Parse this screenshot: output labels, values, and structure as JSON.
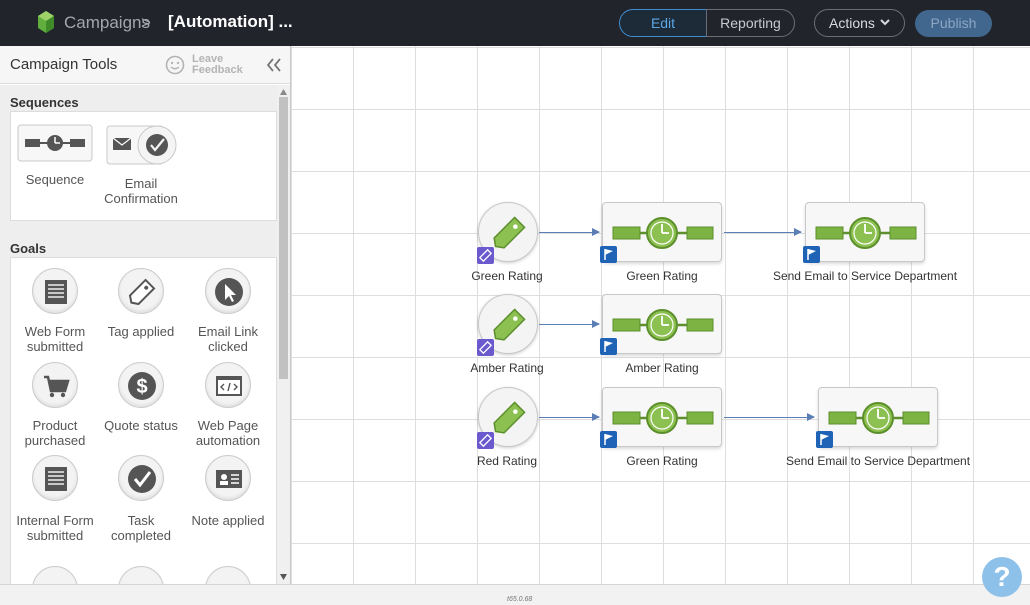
{
  "header": {
    "breadcrumb_root": "Campaigns",
    "breadcrumb_separator": ">",
    "breadcrumb_current": "[Automation] ...",
    "tabs": [
      {
        "label": "Edit",
        "active": true
      },
      {
        "label": "Reporting",
        "active": false
      }
    ],
    "actions_label": "Actions",
    "publish_label": "Publish"
  },
  "sidebar": {
    "title": "Campaign Tools",
    "feedback_line1": "Leave",
    "feedback_line2": "Feedback",
    "sections": [
      {
        "label": "Sequences",
        "tools": [
          {
            "label": "Sequence",
            "icon": "sequence-icon"
          },
          {
            "label": "Email Confirmation",
            "icon": "email-confirmation-icon"
          }
        ]
      },
      {
        "label": "Goals",
        "tools": [
          {
            "label": "Web Form submitted",
            "icon": "web-form-icon"
          },
          {
            "label": "Tag applied",
            "icon": "tag-icon"
          },
          {
            "label": "Email Link clicked",
            "icon": "cursor-icon"
          },
          {
            "label": "Product purchased",
            "icon": "cart-icon"
          },
          {
            "label": "Quote status",
            "icon": "dollar-icon"
          },
          {
            "label": "Web Page automation",
            "icon": "web-page-code-icon"
          },
          {
            "label": "Internal Form submitted",
            "icon": "internal-form-icon"
          },
          {
            "label": "Task completed",
            "icon": "task-check-icon"
          },
          {
            "label": "Note applied",
            "icon": "note-card-icon"
          }
        ]
      }
    ]
  },
  "canvas": {
    "rows": [
      {
        "goal": "Green Rating",
        "sequences": [
          "Green Rating",
          "Send Email to Service Department"
        ]
      },
      {
        "goal": "Amber Rating",
        "sequences": [
          "Amber Rating"
        ]
      },
      {
        "goal": "Red Rating",
        "sequences": [
          "Green Rating",
          "Send Email to Service Department"
        ]
      }
    ]
  },
  "footer": {
    "version": "t65.0.68",
    "help_symbol": "?"
  },
  "colors": {
    "topbar": "#22242c",
    "accent": "#3f8fd1",
    "publish": "#41678f",
    "sequence_green": "#7cb342",
    "flag_badge": "#1e63b5",
    "tag_badge": "#6a5acd",
    "help": "#8ec1ea"
  }
}
